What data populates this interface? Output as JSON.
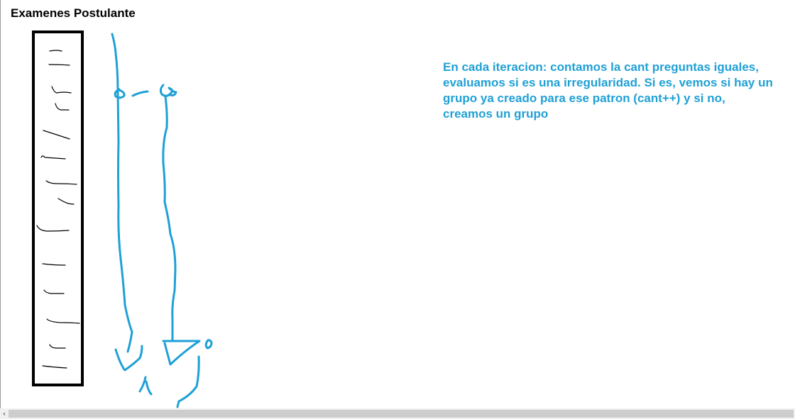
{
  "page": {
    "title": "Examenes Postulante"
  },
  "note": {
    "text": "En cada iteracion: contamos la cant preguntas iguales, evaluamos si es una irregularidad. Si es, vemos si hay un grupo ya creado para ese patron (cant++) y si no, creamos un grupo"
  },
  "scrollbar": {
    "left_arrow": "‹"
  },
  "colors": {
    "sketch_blue": "#1fa0d6",
    "box_black": "#000000",
    "title": "#000000"
  },
  "icons": {
    "scroll_left": "chevron-left-icon"
  }
}
